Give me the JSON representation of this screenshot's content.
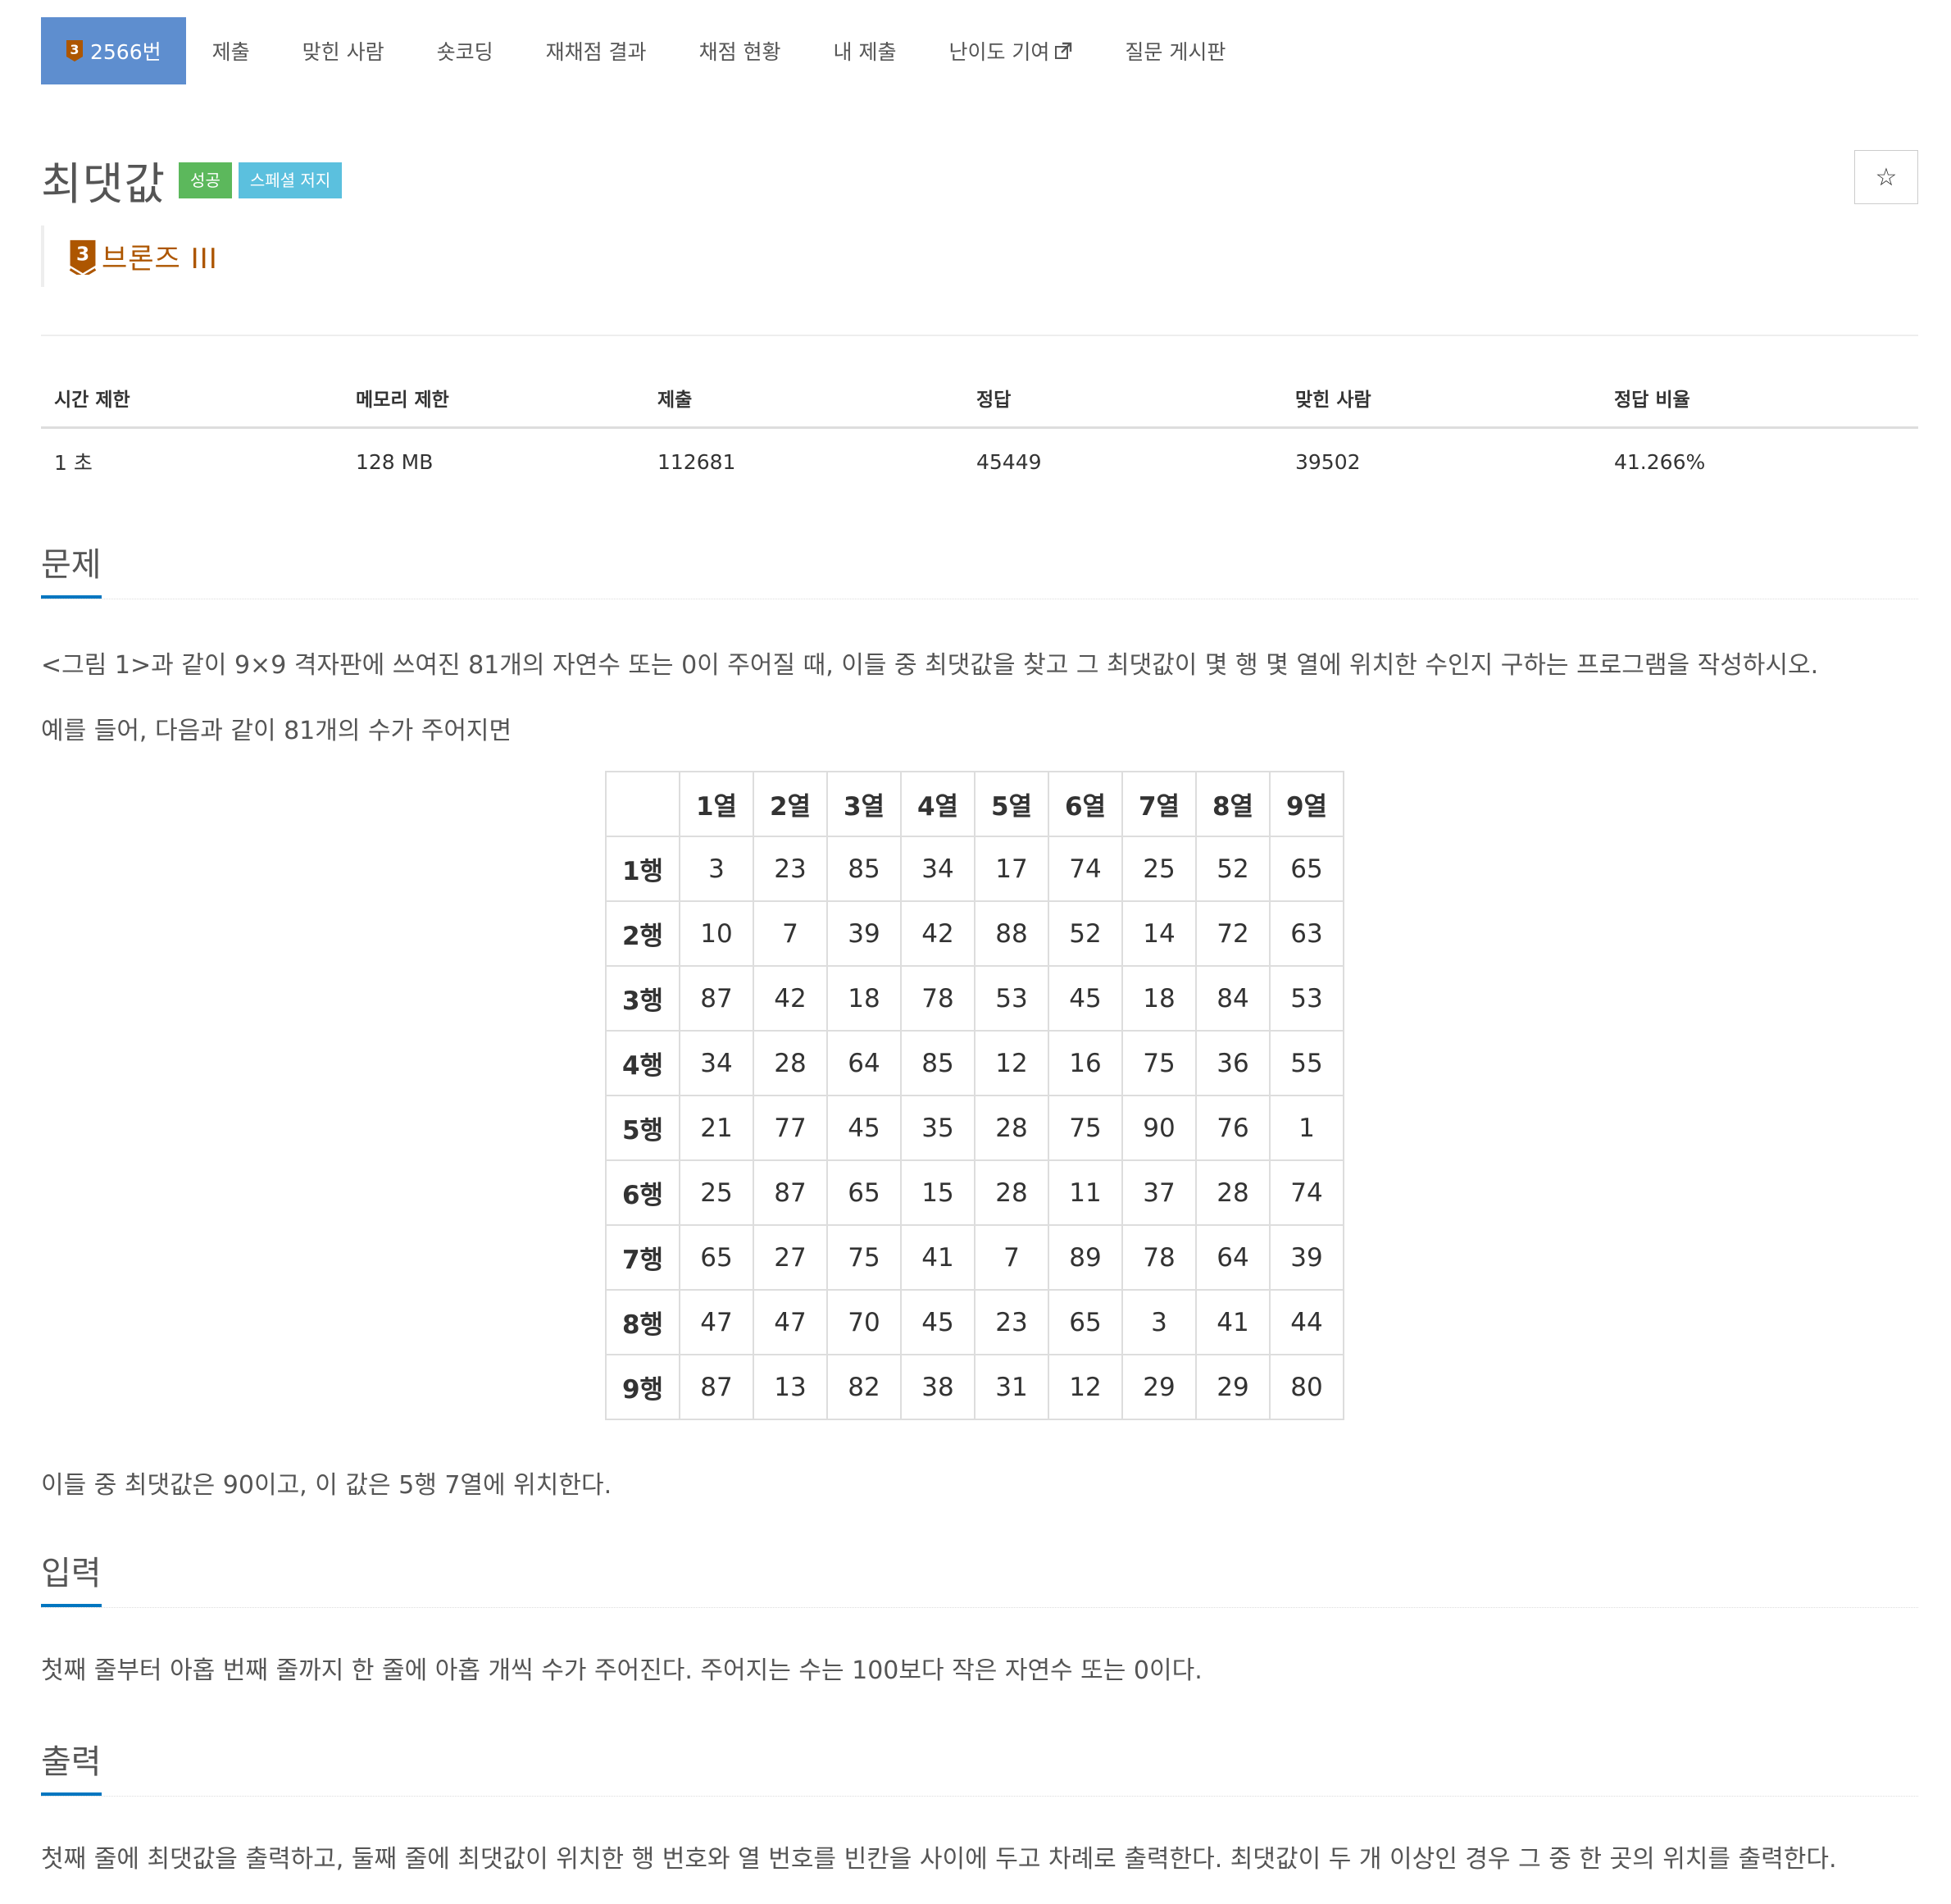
{
  "nav": {
    "items": [
      {
        "label": "2566번",
        "tier_digit": "3",
        "active": true
      },
      {
        "label": "제출"
      },
      {
        "label": "맞힌 사람"
      },
      {
        "label": "숏코딩"
      },
      {
        "label": "재채점 결과"
      },
      {
        "label": "채점 현황"
      },
      {
        "label": "내 제출"
      },
      {
        "label": "난이도 기여",
        "icon": "external-link-icon"
      },
      {
        "label": "질문 게시판"
      }
    ]
  },
  "problem": {
    "title": "최댓값",
    "labels": [
      "성공",
      "스페셜 저지"
    ],
    "tier": {
      "digit": "3",
      "name": "브론즈 III",
      "color": "#ad5600"
    },
    "star": "☆"
  },
  "info": {
    "headers": [
      "시간 제한",
      "메모리 제한",
      "제출",
      "정답",
      "맞힌 사람",
      "정답 비율"
    ],
    "values": [
      "1 초",
      "128 MB",
      "112681",
      "45449",
      "39502",
      "41.266%"
    ]
  },
  "sections": {
    "problem_title": "문제",
    "problem_p1": "<그림 1>과 같이 9×9 격자판에 쓰여진 81개의 자연수 또는 0이 주어질 때, 이들 중 최댓값을 찾고 그 최댓값이 몇 행 몇 열에 위치한 수인지 구하는 프로그램을 작성하시오.",
    "problem_p2": "예를 들어, 다음과 같이 81개의 수가 주어지면",
    "problem_p3": "이들 중 최댓값은 90이고, 이 값은 5행 7열에 위치한다.",
    "input_title": "입력",
    "input_p": "첫째 줄부터 아홉 번째 줄까지 한 줄에 아홉 개씩 수가 주어진다. 주어지는 수는 100보다 작은 자연수 또는 0이다.",
    "output_title": "출력",
    "output_p": "첫째 줄에 최댓값을 출력하고, 둘째 줄에 최댓값이 위치한 행 번호와 열 번호를 빈칸을 사이에 두고 차례로 출력한다. 최댓값이 두 개 이상인 경우 그 중 한 곳의 위치를 출력한다."
  },
  "grid": {
    "col_headers": [
      "1열",
      "2열",
      "3열",
      "4열",
      "5열",
      "6열",
      "7열",
      "8열",
      "9열"
    ],
    "row_headers": [
      "1행",
      "2행",
      "3행",
      "4행",
      "5행",
      "6행",
      "7행",
      "8행",
      "9행"
    ],
    "rows": [
      [
        "3",
        "23",
        "85",
        "34",
        "17",
        "74",
        "25",
        "52",
        "65"
      ],
      [
        "10",
        "7",
        "39",
        "42",
        "88",
        "52",
        "14",
        "72",
        "63"
      ],
      [
        "87",
        "42",
        "18",
        "78",
        "53",
        "45",
        "18",
        "84",
        "53"
      ],
      [
        "34",
        "28",
        "64",
        "85",
        "12",
        "16",
        "75",
        "36",
        "55"
      ],
      [
        "21",
        "77",
        "45",
        "35",
        "28",
        "75",
        "90",
        "76",
        "1"
      ],
      [
        "25",
        "87",
        "65",
        "15",
        "28",
        "11",
        "37",
        "28",
        "74"
      ],
      [
        "65",
        "27",
        "75",
        "41",
        "7",
        "89",
        "78",
        "64",
        "39"
      ],
      [
        "47",
        "47",
        "70",
        "45",
        "23",
        "65",
        "3",
        "41",
        "44"
      ],
      [
        "87",
        "13",
        "82",
        "38",
        "31",
        "12",
        "29",
        "29",
        "80"
      ]
    ]
  }
}
